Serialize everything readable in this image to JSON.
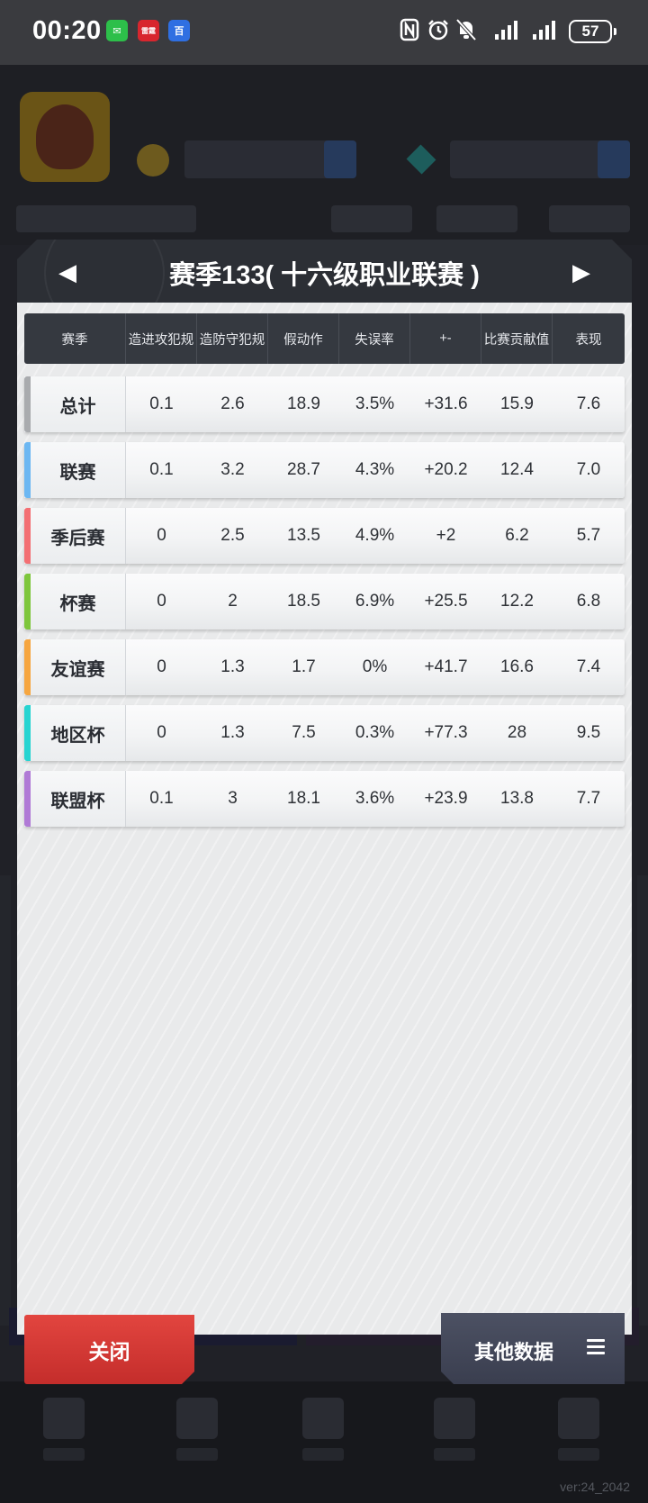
{
  "status_bar": {
    "time": "00:20",
    "app_icons": [
      {
        "name": "wechat-icon",
        "label": "✉"
      },
      {
        "name": "news-app-icon",
        "label": "雷霆"
      },
      {
        "name": "baidu-icon",
        "label": "百"
      }
    ],
    "battery": "57"
  },
  "modal": {
    "title": "赛季133( 十六级职业联赛 )",
    "prev_arrow": "◀",
    "next_arrow": "▶",
    "columns": [
      "赛季",
      "造进攻犯规",
      "造防守犯规",
      "假动作",
      "失误率",
      "+-",
      "比赛贡献值",
      "表现"
    ],
    "rows": [
      {
        "label": "总计",
        "values": [
          "0.1",
          "2.6",
          "18.9",
          "3.5%",
          "+31.6",
          "15.9",
          "7.6"
        ],
        "accent": "#a9abae"
      },
      {
        "label": "联赛",
        "values": [
          "0.1",
          "3.2",
          "28.7",
          "4.3%",
          "+20.2",
          "12.4",
          "7.0"
        ],
        "accent": "#6cb7f2"
      },
      {
        "label": "季后赛",
        "values": [
          "0",
          "2.5",
          "13.5",
          "4.9%",
          "+2",
          "6.2",
          "5.7"
        ],
        "accent": "#f36f73"
      },
      {
        "label": "杯赛",
        "values": [
          "0",
          "2",
          "18.5",
          "6.9%",
          "+25.5",
          "12.2",
          "6.8"
        ],
        "accent": "#7ec63c"
      },
      {
        "label": "友谊赛",
        "values": [
          "0",
          "1.3",
          "1.7",
          "0%",
          "+41.7",
          "16.6",
          "7.4"
        ],
        "accent": "#f6a640"
      },
      {
        "label": "地区杯",
        "values": [
          "0",
          "1.3",
          "7.5",
          "0.3%",
          "+77.3",
          "28",
          "9.5"
        ],
        "accent": "#27d4d1"
      },
      {
        "label": "联盟杯",
        "values": [
          "0.1",
          "3",
          "18.1",
          "3.6%",
          "+23.9",
          "13.8",
          "7.7"
        ],
        "accent": "#b07ad6"
      }
    ],
    "close_button": "关闭",
    "other_data_button": "其他数据"
  },
  "version": "ver:24_2042"
}
